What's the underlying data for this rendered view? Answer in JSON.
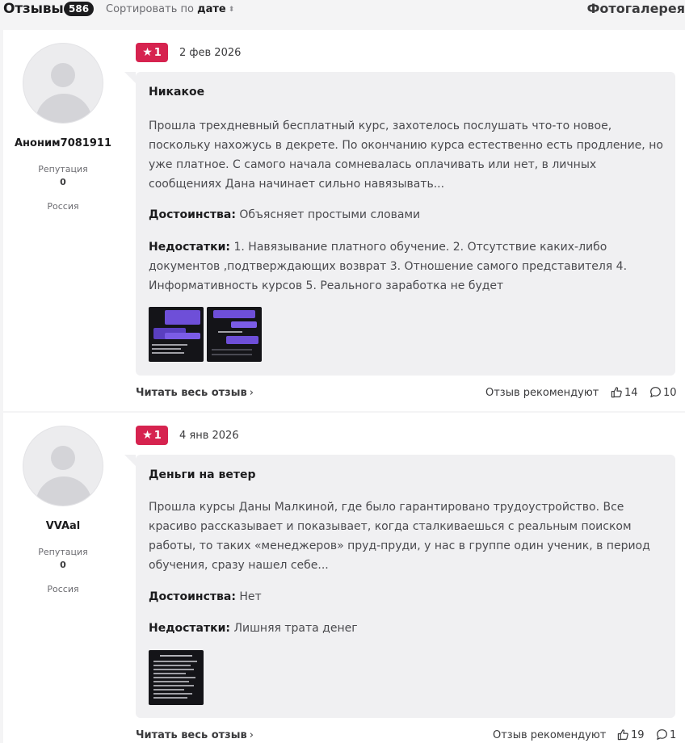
{
  "header": {
    "title": "Отзывы",
    "count": "586",
    "sort_prefix": "Сортировать по",
    "sort_value": "дате",
    "gallery": "Фотогалерея"
  },
  "common": {
    "reputation_label": "Репутация",
    "pros_label": "Достоинства:",
    "cons_label": "Недостатки:",
    "read_full": "Читать весь отзыв",
    "recommend": "Отзыв рекомендуют"
  },
  "reviews": [
    {
      "author": "Аноним7081911",
      "reputation": "0",
      "country": "Россия",
      "rating": "1",
      "date": "2 фев 2026",
      "title": "Никакое",
      "body": "Прошла трехдневный бесплатный курс, захотелось послушать что-то новое, поскольку нахожусь в декрете. По окончанию курса естественно есть продление, но уже платное. С самого начала сомневалась оплачивать или нет, в личных сообщениях Дана начинает сильно навязывать...",
      "pros": "Объясняет простыми словами",
      "cons": "1. Навязывание платного обучение. 2. Отсутствие каких-либо документов ,подтверждающих возврат 3. Отношение самого представителя 4. Информативность курсов 5. Реального заработка не будет",
      "likes": "14",
      "comments": "10"
    },
    {
      "author": "VVAal",
      "reputation": "0",
      "country": "Россия",
      "rating": "1",
      "date": "4 янв 2026",
      "title": "Деньги на ветер",
      "body": "Прошла курсы Даны Малкиной, где было гарантировано трудоустройство. Все красиво рассказывает и показывает, когда сталкиваешься с реальным поиском работы, то таких «менеджеров» пруд-пруди, у нас в группе один ученик, в период обучения, сразу нашел себе...",
      "pros": "Нет",
      "cons": "Лишняя трата денег",
      "likes": "19",
      "comments": "1"
    }
  ],
  "colors": {
    "rating_badge": "#d6234f",
    "count_badge": "#1c1c1e",
    "bubble_bg": "#f0f0f2",
    "page_bg": "#f4f4f5"
  },
  "icons": [
    "sort-icon",
    "star-icon",
    "thumbs-up-icon",
    "comment-icon",
    "chevron-right-icon",
    "avatar-placeholder-icon"
  ]
}
